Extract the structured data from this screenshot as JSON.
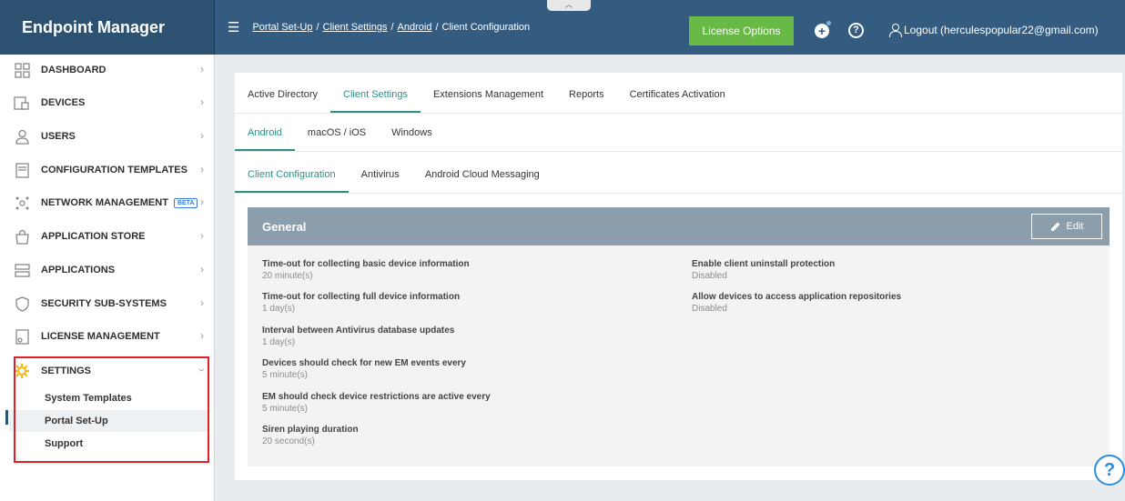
{
  "header": {
    "brand": "Endpoint Manager",
    "collapse_handle": "︿",
    "breadcrumbs": [
      {
        "label": "Portal Set-Up",
        "link": true
      },
      {
        "label": "Client Settings",
        "link": true
      },
      {
        "label": "Android",
        "link": true
      },
      {
        "label": "Client Configuration",
        "link": false
      }
    ],
    "separator": "/",
    "license_button": "License Options",
    "help_glyph": "?",
    "logout_text": "Logout (herculespopular22@gmail.com)"
  },
  "sidebar": {
    "items": [
      {
        "label": "DASHBOARD",
        "icon": "dashboard-icon"
      },
      {
        "label": "DEVICES",
        "icon": "devices-icon"
      },
      {
        "label": "USERS",
        "icon": "users-icon"
      },
      {
        "label": "CONFIGURATION TEMPLATES",
        "icon": "configuration-templates-icon"
      },
      {
        "label": "NETWORK MANAGEMENT",
        "icon": "network-management-icon",
        "badge": "BETA"
      },
      {
        "label": "APPLICATION STORE",
        "icon": "application-store-icon"
      },
      {
        "label": "APPLICATIONS",
        "icon": "applications-icon"
      },
      {
        "label": "SECURITY SUB-SYSTEMS",
        "icon": "security-subsystems-icon"
      },
      {
        "label": "LICENSE MANAGEMENT",
        "icon": "license-management-icon"
      },
      {
        "label": "SETTINGS",
        "icon": "settings-icon",
        "expanded": true
      }
    ],
    "settings_sub": [
      {
        "label": "System Templates"
      },
      {
        "label": "Portal Set-Up",
        "active": true
      },
      {
        "label": "Support"
      }
    ],
    "highlight_color": "#e31e24"
  },
  "main": {
    "tabs_l1": [
      "Active Directory",
      "Client Settings",
      "Extensions Management",
      "Reports",
      "Certificates Activation"
    ],
    "tabs_l1_active": "Client Settings",
    "tabs_l2": [
      "Android",
      "macOS / iOS",
      "Windows"
    ],
    "tabs_l2_active": "Android",
    "tabs_l3": [
      "Client Configuration",
      "Antivirus",
      "Android Cloud Messaging"
    ],
    "tabs_l3_active": "Client Configuration",
    "panel": {
      "title": "General",
      "edit_label": "Edit",
      "left_fields": [
        {
          "label": "Time-out for collecting basic device information",
          "value": "20 minute(s)"
        },
        {
          "label": "Time-out for collecting full device information",
          "value": "1 day(s)"
        },
        {
          "label": "Interval between Antivirus database updates",
          "value": "1 day(s)"
        },
        {
          "label": "Devices should check for new EM events every",
          "value": "5 minute(s)"
        },
        {
          "label": "EM should check device restrictions are active every",
          "value": "5 minute(s)"
        },
        {
          "label": "Siren playing duration",
          "value": "20 second(s)"
        }
      ],
      "right_fields": [
        {
          "label": "Enable client uninstall protection",
          "value": "Disabled"
        },
        {
          "label": "Allow devices to access application repositories",
          "value": "Disabled"
        }
      ]
    }
  },
  "colors": {
    "brand_bg": "#2c5171",
    "topbar_bg": "#335c80",
    "license_green": "#68b945",
    "active_tab": "#2e8f85",
    "panel_header": "#8c9dac"
  },
  "floating_help": "?"
}
